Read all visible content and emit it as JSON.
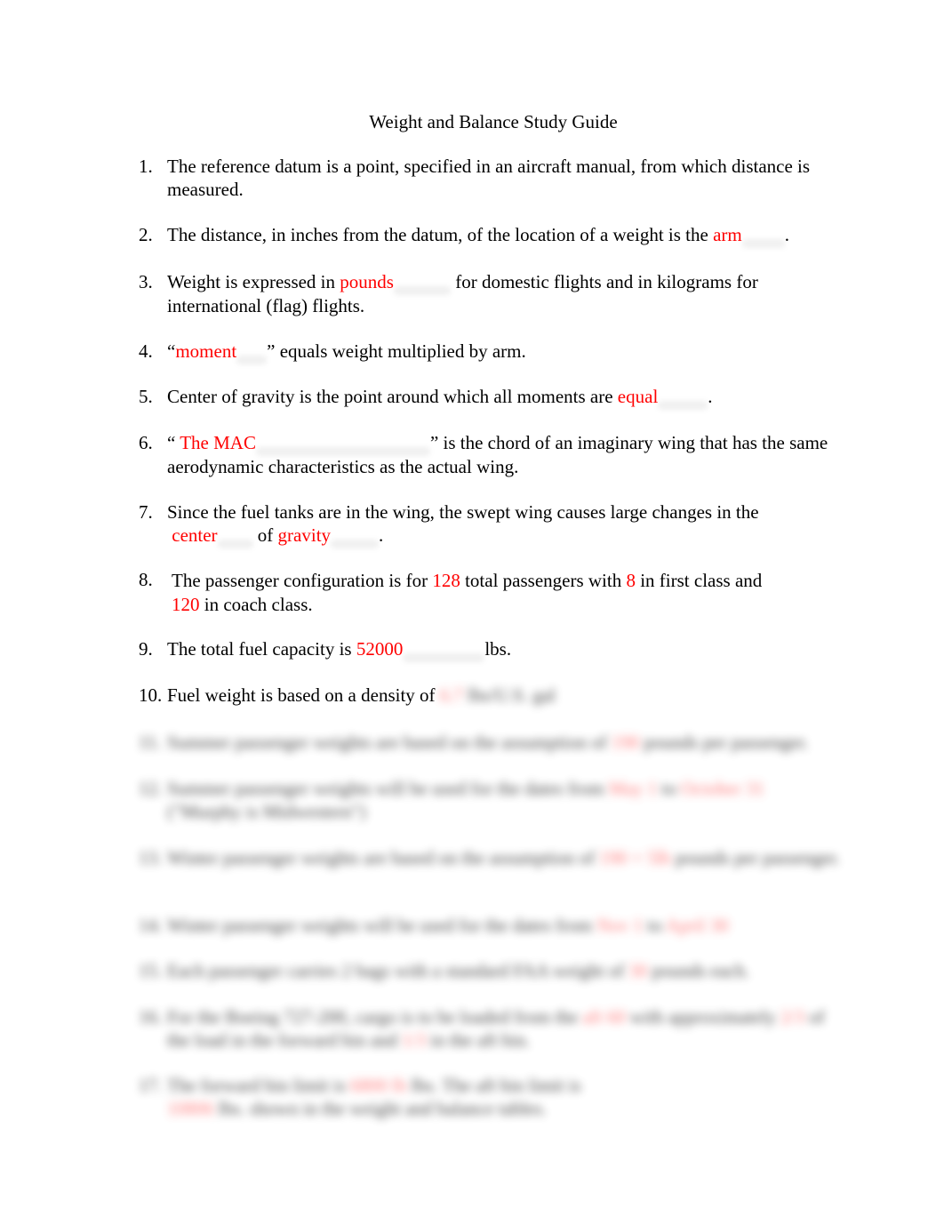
{
  "document": {
    "title": "Weight and Balance Study Guide",
    "answer_color": "#ff0000",
    "items": [
      {
        "num": "1.",
        "parts": [
          "The reference datum is a point, specified in an aircraft manual, from which distance is measured."
        ]
      },
      {
        "num": "2.",
        "pre": "The distance, in inches from the datum, of the location of a weight is the ",
        "answer": "arm",
        "post": "."
      },
      {
        "num": "3.",
        "pre": "Weight is expressed in ",
        "answer": "pounds",
        "post": " for domestic flights and in kilograms for international (flag) flights."
      },
      {
        "num": "4.",
        "pre": "“",
        "answer": "moment",
        "post": "” equals weight multiplied by arm."
      },
      {
        "num": "5.",
        "pre": "Center of gravity is the point around which all moments are ",
        "answer": "equal",
        "post": "."
      },
      {
        "num": "6.",
        "pre": "“ ",
        "answer": "The MAC",
        "post": "” is the chord of an imaginary wing that has the same aerodynamic characteristics as the actual wing."
      },
      {
        "num": "7.",
        "pre": "Since the fuel tanks are in the wing, the swept wing causes large changes in the",
        "answer": "center",
        "mid": " of ",
        "answer2": "gravity",
        "post": "."
      },
      {
        "num": "8.",
        "pre": "The passenger configuration is for ",
        "answer": "128",
        "mid": " total passengers with ",
        "answer2": "8",
        "mid2": " in first class and",
        "answer3": "120",
        "post": " in coach class."
      },
      {
        "num": "9.",
        "pre": "The total fuel capacity is ",
        "answer": "52000",
        "post": "lbs."
      },
      {
        "num": "10.",
        "pre": "Fuel weight is based on a density of ",
        "answer": "6.7",
        "post": " lbs/U.S. gal"
      }
    ],
    "blurred_items": [
      {
        "num": "11.",
        "pre": "Summer passenger weights are based on the assumption of ",
        "answer": "190",
        "post": " pounds per passenger."
      },
      {
        "num": "12.",
        "pre": "Summer passenger weights will be used for the dates from ",
        "answer": "May 1",
        "mid": " to ",
        "answer2": "October 31",
        "post": " (\"Murphy is Midwestern\")"
      },
      {
        "num": "13.",
        "pre": "Winter passenger weights are based on the assumption of ",
        "answer": "190 + 5lb",
        "post": " pounds per passenger."
      },
      {
        "num": "14.",
        "pre": "Winter passenger weights will be used for the dates from ",
        "answer": "Nov 1",
        "mid": " to ",
        "answer2": "April 30"
      },
      {
        "num": "15.",
        "pre": "Each passenger carries 2 bags with a standard FAA weight of ",
        "answer": "30",
        "post": " pounds each."
      },
      {
        "num": "16.",
        "pre": "For the Boeing 727-200, cargo is to be loaded from the ",
        "answer": "aft 60",
        "post": " with approximately ",
        "answer2": "2/3",
        "mid": " of the load in the forward bin and ",
        "answer3": "1/3",
        "post2": " in the aft bin."
      },
      {
        "num": "17.",
        "pre": "The forward bin limit is ",
        "answer": "6800 lb",
        "mid": " lbs. The aft bin limit is",
        "answer2": "10806",
        "post": " lbs. shown in the weight and balance tables."
      }
    ]
  }
}
